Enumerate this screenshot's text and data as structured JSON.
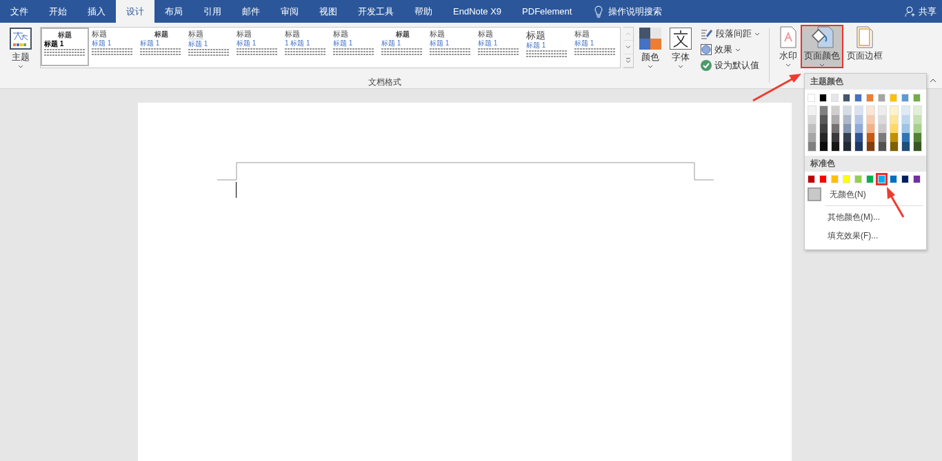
{
  "tabs": [
    {
      "label": "文件",
      "selected": false
    },
    {
      "label": "开始",
      "selected": false
    },
    {
      "label": "插入",
      "selected": false
    },
    {
      "label": "设计",
      "selected": true
    },
    {
      "label": "布局",
      "selected": false
    },
    {
      "label": "引用",
      "selected": false
    },
    {
      "label": "邮件",
      "selected": false
    },
    {
      "label": "审阅",
      "selected": false
    },
    {
      "label": "视图",
      "selected": false
    },
    {
      "label": "开发工具",
      "selected": false
    },
    {
      "label": "帮助",
      "selected": false
    },
    {
      "label": "EndNote X9",
      "selected": false
    },
    {
      "label": "PDFelement",
      "selected": false
    }
  ],
  "tell_me": "操作说明搜索",
  "share": "共享",
  "ribbon": {
    "themes_button": "主题",
    "style_gallery": [
      {
        "kind": "centered",
        "title": "标题",
        "heading": "标题 1",
        "selected": true
      },
      {
        "kind": "left",
        "title": "标题",
        "heading": "标题 1",
        "selected": false
      },
      {
        "kind": "centered",
        "title": "标题",
        "heading": "标题 1",
        "selected": false
      },
      {
        "kind": "underlined",
        "title": "标题",
        "heading": "标题 1",
        "selected": false
      },
      {
        "kind": "left",
        "title": "标题",
        "heading": "标题 1",
        "selected": false
      },
      {
        "kind": "left",
        "title": "标题",
        "heading": "1 标题 1",
        "selected": false
      },
      {
        "kind": "left",
        "title": "标题",
        "heading": "标题 1",
        "selected": false
      },
      {
        "kind": "centered",
        "title": "标题",
        "heading": "标题 1",
        "selected": false
      },
      {
        "kind": "left",
        "title": "标题",
        "heading": "标题 1",
        "selected": false
      },
      {
        "kind": "left",
        "title": "标题",
        "heading": "标题 1",
        "selected": false
      },
      {
        "kind": "large",
        "title": "标题",
        "heading": "标题 1",
        "selected": false
      },
      {
        "kind": "left",
        "title": "标题",
        "heading": "标题 1",
        "selected": false
      }
    ],
    "colors_button": "颜色",
    "fonts_button": "字体",
    "small_buttons": [
      {
        "kind": "spacing",
        "label": "段落间距",
        "dropdown": true
      },
      {
        "kind": "effects",
        "label": "效果",
        "dropdown": true
      },
      {
        "kind": "default",
        "label": "设为默认值",
        "dropdown": false
      }
    ],
    "group_label": "文档格式",
    "page_background_buttons": [
      {
        "kind": "watermark",
        "label": "水印",
        "pressed": false
      },
      {
        "kind": "page-color",
        "label": "页面颜色",
        "pressed": true
      },
      {
        "kind": "page-border",
        "label": "页面边框",
        "pressed": false
      }
    ]
  },
  "page_color_menu": {
    "theme_header": "主题颜色",
    "theme_colors": [
      {
        "color": "#ffffff",
        "shades": [
          {
            "color": "#f2f2f2"
          },
          {
            "color": "#d9d9d9"
          },
          {
            "color": "#bfbfbf"
          },
          {
            "color": "#a6a6a6"
          },
          {
            "color": "#808080"
          }
        ]
      },
      {
        "color": "#000000",
        "shades": [
          {
            "color": "#808080"
          },
          {
            "color": "#595959"
          },
          {
            "color": "#404040"
          },
          {
            "color": "#262626"
          },
          {
            "color": "#0d0d0d"
          }
        ]
      },
      {
        "color": "#e7e6e6",
        "shades": [
          {
            "color": "#d0cece"
          },
          {
            "color": "#aeabab"
          },
          {
            "color": "#757171"
          },
          {
            "color": "#3a3838"
          },
          {
            "color": "#171616"
          }
        ]
      },
      {
        "color": "#44546a",
        "shades": [
          {
            "color": "#d6dce4"
          },
          {
            "color": "#adb9ca"
          },
          {
            "color": "#8497b0"
          },
          {
            "color": "#333f4f"
          },
          {
            "color": "#222a35"
          }
        ]
      },
      {
        "color": "#4472c4",
        "shades": [
          {
            "color": "#d9e2f3"
          },
          {
            "color": "#b4c6e7"
          },
          {
            "color": "#8eaadb"
          },
          {
            "color": "#2f5496"
          },
          {
            "color": "#1f3864"
          }
        ]
      },
      {
        "color": "#ed7d31",
        "shades": [
          {
            "color": "#fbe5d5"
          },
          {
            "color": "#f7cbac"
          },
          {
            "color": "#f4b183"
          },
          {
            "color": "#c55a11"
          },
          {
            "color": "#833c0b"
          }
        ]
      },
      {
        "color": "#a5a5a5",
        "shades": [
          {
            "color": "#ededed"
          },
          {
            "color": "#dbdbdb"
          },
          {
            "color": "#c9c9c9"
          },
          {
            "color": "#7b7b7b"
          },
          {
            "color": "#525252"
          }
        ]
      },
      {
        "color": "#ffc000",
        "shades": [
          {
            "color": "#fff2cc"
          },
          {
            "color": "#fee599"
          },
          {
            "color": "#ffd966"
          },
          {
            "color": "#bf9000"
          },
          {
            "color": "#7f6000"
          }
        ]
      },
      {
        "color": "#5b9bd5",
        "shades": [
          {
            "color": "#deebf6"
          },
          {
            "color": "#bdd7ee"
          },
          {
            "color": "#9dc3e6"
          },
          {
            "color": "#2e75b5"
          },
          {
            "color": "#1e4e79"
          }
        ]
      },
      {
        "color": "#70ad47",
        "shades": [
          {
            "color": "#e2efd9"
          },
          {
            "color": "#c5e0b3"
          },
          {
            "color": "#a8d08d"
          },
          {
            "color": "#538135"
          },
          {
            "color": "#375623"
          }
        ]
      }
    ],
    "standard_header": "标准色",
    "standard_colors": [
      {
        "color": "#c00000",
        "selected": false
      },
      {
        "color": "#ff0000",
        "selected": false
      },
      {
        "color": "#ffc000",
        "selected": false
      },
      {
        "color": "#ffff00",
        "selected": false
      },
      {
        "color": "#92d050",
        "selected": false
      },
      {
        "color": "#00b050",
        "selected": false
      },
      {
        "color": "#00b0f0",
        "selected": true
      },
      {
        "color": "#0070c0",
        "selected": false
      },
      {
        "color": "#002060",
        "selected": false
      },
      {
        "color": "#7030a0",
        "selected": false
      }
    ],
    "no_color": "无颜色(N)",
    "items": [
      "其他颜色(M)...",
      "填充效果(F)..."
    ]
  }
}
